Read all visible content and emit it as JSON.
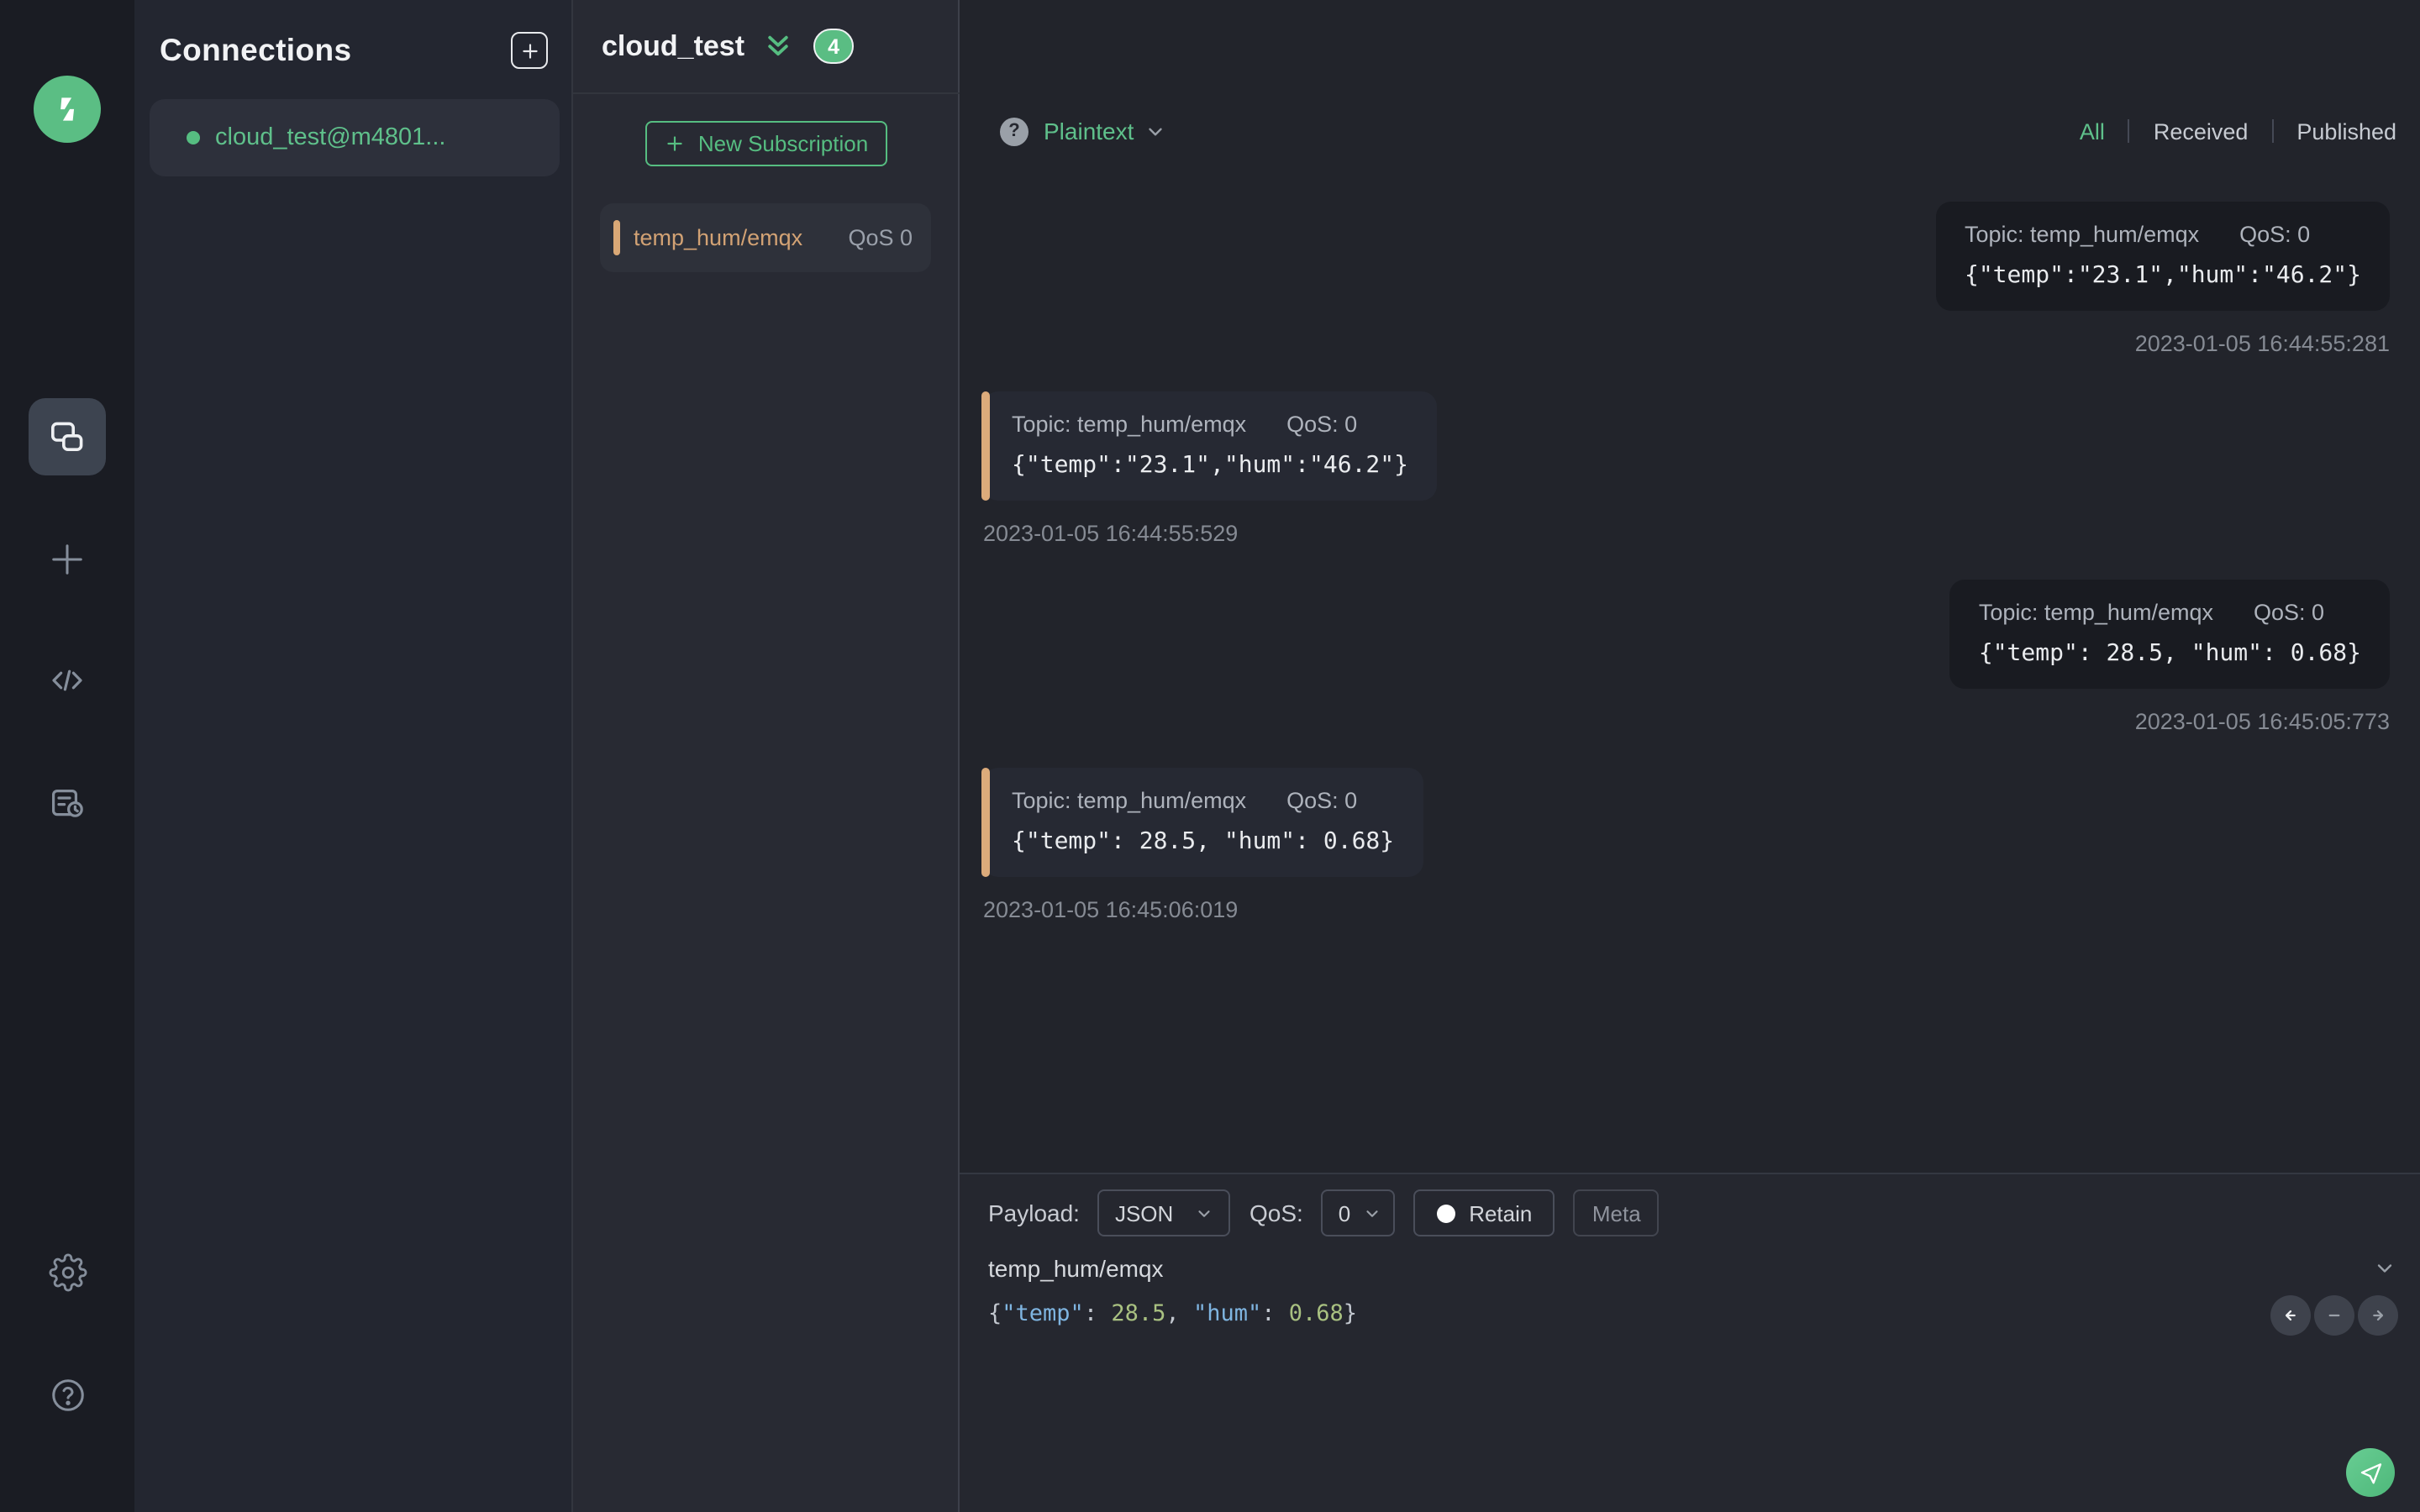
{
  "topbar": {
    "title": "cloud_test",
    "badge_count": "4"
  },
  "connections_panel": {
    "title": "Connections",
    "items": [
      {
        "label": "cloud_test@m4801...",
        "connected": true
      }
    ]
  },
  "subscriptions_panel": {
    "new_subscription_label": "New Subscription",
    "items": [
      {
        "topic": "temp_hum/emqx",
        "qos": "QoS 0"
      }
    ]
  },
  "filter_bar": {
    "help_glyph": "?",
    "payload_format": "Plaintext",
    "tabs": [
      "All",
      "Received",
      "Published"
    ],
    "active_tab": "All"
  },
  "messages": [
    {
      "direction": "published",
      "topic_label": "Topic: temp_hum/emqx",
      "qos_label": "QoS: 0",
      "payload": "{\"temp\":\"23.1\",\"hum\":\"46.2\"}",
      "timestamp": "2023-01-05 16:44:55:281"
    },
    {
      "direction": "received",
      "topic_label": "Topic: temp_hum/emqx",
      "qos_label": "QoS: 0",
      "payload": "{\"temp\":\"23.1\",\"hum\":\"46.2\"}",
      "timestamp": "2023-01-05 16:44:55:529"
    },
    {
      "direction": "published",
      "topic_label": "Topic: temp_hum/emqx",
      "qos_label": "QoS: 0",
      "payload": "{\"temp\": 28.5, \"hum\": 0.68}",
      "timestamp": "2023-01-05 16:45:05:773"
    },
    {
      "direction": "received",
      "topic_label": "Topic: temp_hum/emqx",
      "qos_label": "QoS: 0",
      "payload": "{\"temp\": 28.5, \"hum\": 0.68}",
      "timestamp": "2023-01-05 16:45:06:019"
    }
  ],
  "publish_panel": {
    "payload_label": "Payload:",
    "payload_format": "JSON",
    "qos_label": "QoS:",
    "qos_value": "0",
    "retain_label": "Retain",
    "meta_label": "Meta",
    "topic": "temp_hum/emqx",
    "payload_preview": "{\"temp\": 28.5, \"hum\": 0.68}",
    "editor_tokens": [
      {
        "text": "{",
        "type": "punct"
      },
      {
        "text": "\"temp\"",
        "type": "key"
      },
      {
        "text": ": ",
        "type": "punct"
      },
      {
        "text": "28.5",
        "type": "number"
      },
      {
        "text": ", ",
        "type": "punct"
      },
      {
        "text": "\"hum\"",
        "type": "key"
      },
      {
        "text": ": ",
        "type": "punct"
      },
      {
        "text": "0.68",
        "type": "number"
      },
      {
        "text": "}",
        "type": "punct"
      }
    ]
  },
  "icons": {
    "sidebar": [
      "mqttx-logo",
      "connections-icon",
      "new-connection-icon",
      "code-icon",
      "log-icon",
      "settings-icon",
      "help-icon"
    ],
    "topbar": [
      "disconnect-power-icon",
      "edit-icon",
      "more-ellipsis-icon"
    ],
    "publish": [
      "history-prev-icon",
      "clear-icon",
      "history-next-icon",
      "send-icon"
    ]
  },
  "colors": {
    "accent_green": "#56bd81",
    "badge_green": "#5abd83",
    "subscription_orange": "#d9a876",
    "power_red": "#e0695f",
    "editor_key_blue": "#7fb5e1",
    "editor_number_green": "#a9c181",
    "panel_dark": "#22242b",
    "sidebar_dark": "#1a1c23"
  }
}
